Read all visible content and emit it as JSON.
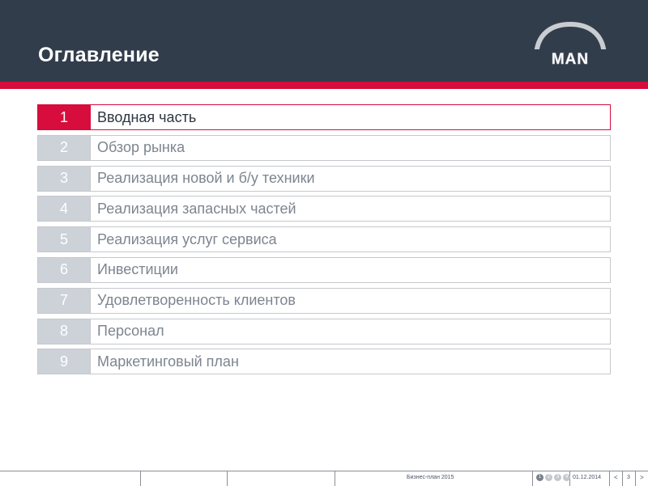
{
  "header": {
    "title": "Оглавление",
    "logo_text": "MAN",
    "colors": {
      "background": "#323d4c",
      "accent": "#d60d3d"
    }
  },
  "toc": {
    "active_index": 0,
    "items": [
      {
        "num": "1",
        "label": "Вводная часть"
      },
      {
        "num": "2",
        "label": "Обзор рынка"
      },
      {
        "num": "3",
        "label": "Реализация новой и б/у техники"
      },
      {
        "num": "4",
        "label": "Реализация запасных частей"
      },
      {
        "num": "5",
        "label": "Реализация услуг сервиса"
      },
      {
        "num": "6",
        "label": "Инвестиции"
      },
      {
        "num": "7",
        "label": "Удовлетворенность клиентов"
      },
      {
        "num": "8",
        "label": "Персонал"
      },
      {
        "num": "9",
        "label": "Маркетинговый план"
      }
    ]
  },
  "footer": {
    "document": "Бизнес-план 2015",
    "section_dots": [
      "1",
      "2",
      "3",
      "4"
    ],
    "active_dot": 0,
    "date": "01.12.2014",
    "page": "3",
    "prev": "<",
    "next": ">"
  }
}
